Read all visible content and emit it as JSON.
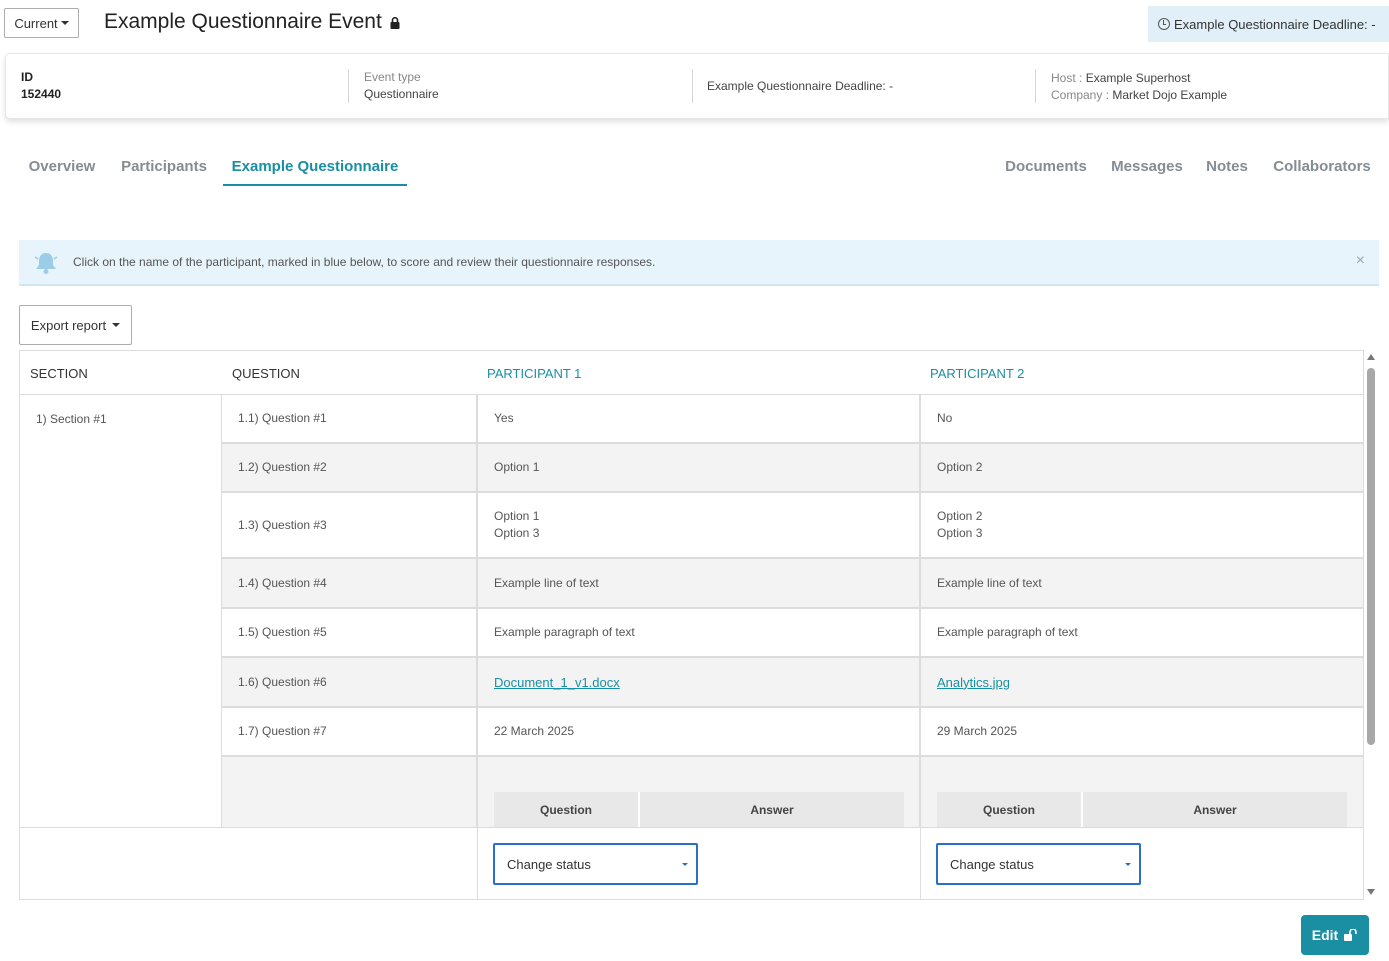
{
  "header": {
    "version_selector": "Current",
    "title": "Example Questionnaire Event",
    "deadline_badge": "Example Questionnaire Deadline: -"
  },
  "info": {
    "id_label": "ID",
    "id_value": "152440",
    "event_type_label": "Event type",
    "event_type_value": "Questionnaire",
    "deadline": "Example Questionnaire Deadline: -",
    "host_label": "Host :",
    "host_value": "Example Superhost",
    "company_label": "Company :",
    "company_value": "Market Dojo Example"
  },
  "tabs": {
    "overview": "Overview",
    "participants": "Participants",
    "questionnaire": "Example Questionnaire",
    "documents": "Documents",
    "messages": "Messages",
    "notes": "Notes",
    "collaborators": "Collaborators"
  },
  "alert": {
    "text": "Click on the name of the participant, marked in blue below, to score and review their questionnaire responses.",
    "close": "×"
  },
  "export_label": "Export report",
  "table": {
    "headers": {
      "section": "SECTION",
      "question": "QUESTION",
      "participant1": "PARTICIPANT 1",
      "participant2": "PARTICIPANT 2"
    },
    "section_name": "1) Section #1",
    "rows": [
      {
        "question": "1.1) Question #1",
        "p1": "Yes",
        "p2": "No"
      },
      {
        "question": "1.2) Question #2",
        "p1": "Option 1",
        "p2": "Option 2"
      },
      {
        "question": "1.3) Question #3",
        "p1": "Option 1",
        "p1b": "Option 3",
        "p2": "Option 2",
        "p2b": "Option 3"
      },
      {
        "question": "1.4) Question #4",
        "p1": "Example line of text",
        "p2": "Example line of text"
      },
      {
        "question": "1.5) Question #5",
        "p1": "Example paragraph of text",
        "p2": "Example paragraph of text"
      },
      {
        "question": "1.6) Question #6",
        "p1": "Document_1_v1.docx",
        "p2": "Analytics.jpg"
      },
      {
        "question": "1.7) Question #7",
        "p1": "22 March 2025",
        "p2": "29 March 2025"
      }
    ],
    "subtable": {
      "question": "Question",
      "answer": "Answer"
    },
    "change_status": "Change status"
  },
  "edit_label": "Edit",
  "colors": {
    "accent": "#1a8fa3",
    "alert_bg": "#e8f4fb",
    "select_border": "#2a6fc9"
  }
}
